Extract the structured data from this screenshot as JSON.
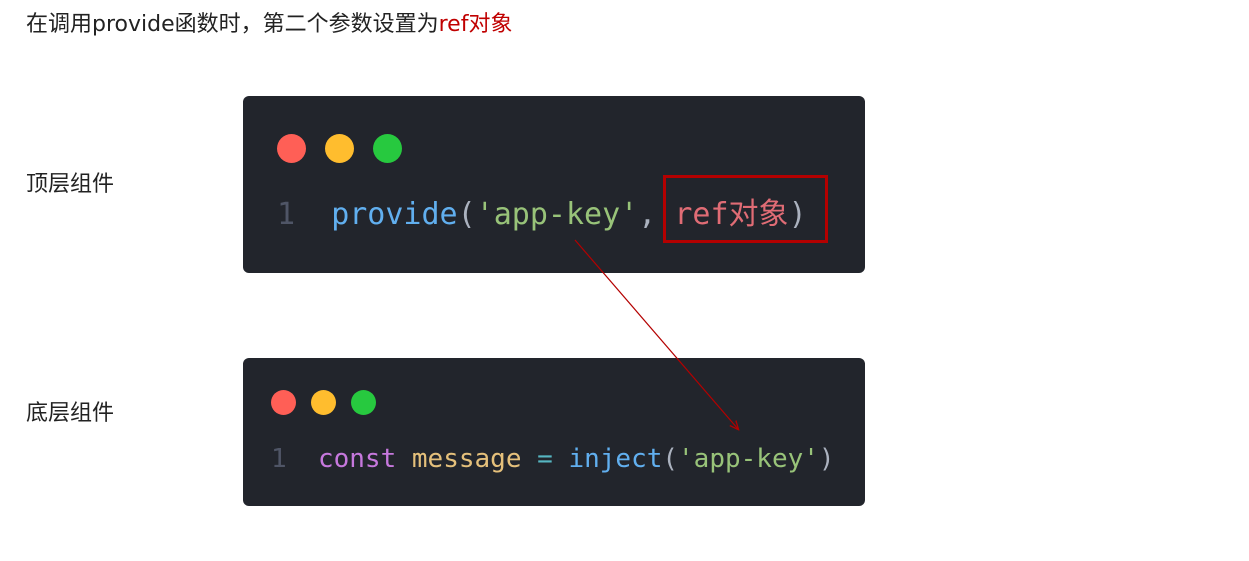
{
  "heading": {
    "text": "在调用provide函数时，第二个参数设置为",
    "highlight": "ref对象",
    "highlight_color": "#c00000"
  },
  "labels": {
    "top": "顶层组件",
    "bottom": "底层组件"
  },
  "top_code": {
    "line_number": "1",
    "fn": "provide",
    "open_paren": "(",
    "arg1": "'app-key'",
    "comma": ", ",
    "arg2": "ref对象",
    "close_paren": ")"
  },
  "bottom_code": {
    "line_number": "1",
    "keyword": "const",
    "variable": "message",
    "operator": "=",
    "fn": "inject",
    "open_paren": "(",
    "arg": "'app-key'",
    "close_paren": ")"
  },
  "colors": {
    "editor_background": "#22252c",
    "annotation": "#b40000",
    "window_dots": [
      "#ff5f56",
      "#ffbd2e",
      "#27c93f"
    ]
  }
}
